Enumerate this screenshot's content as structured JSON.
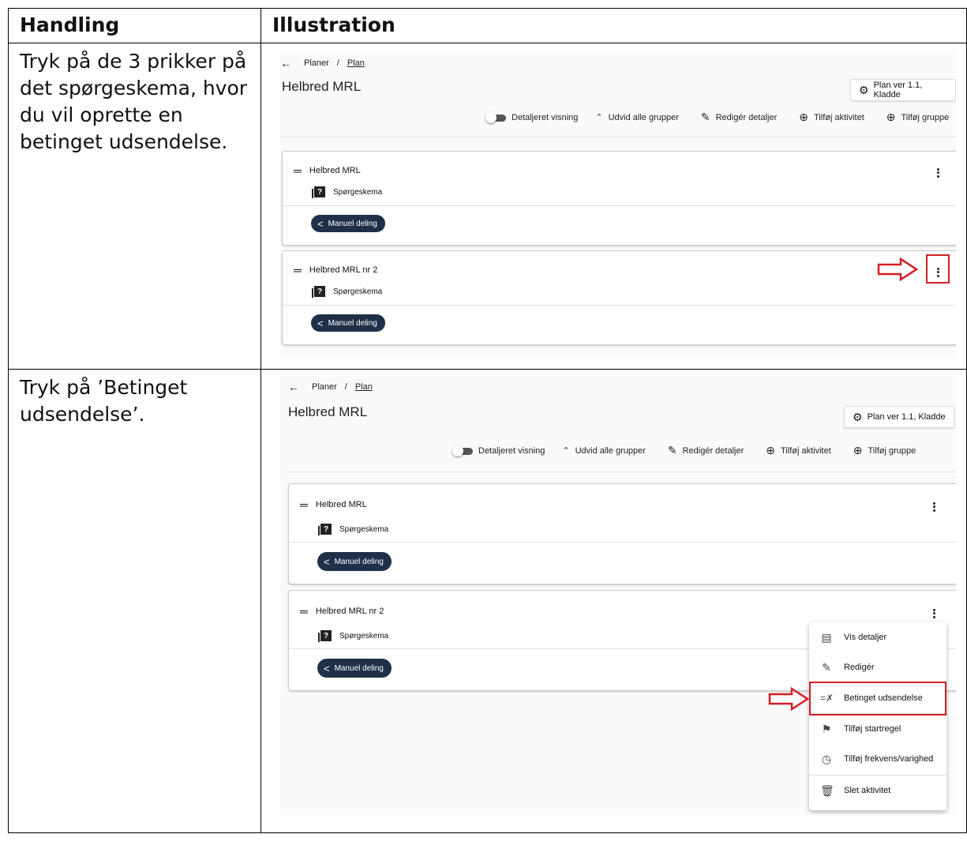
{
  "table": {
    "col_handling": "Handling",
    "col_illustration": "Illustration"
  },
  "steps": [
    {
      "text": "Tryk på de 3 prikker på det spørgeskema, hvor du vil oprette en betinget udsendelse."
    },
    {
      "text": "Tryk på ’Betinget udsendelse’."
    }
  ],
  "ui": {
    "breadcrumb_root": "Planer",
    "breadcrumb_sep": "/",
    "breadcrumb_current": "Plan",
    "page_title": "Helbred MRL",
    "plan_button": "Plan ver 1.1, Kladde",
    "toolbar": {
      "detailed_view": "Detaljeret visning",
      "expand_groups": "Udvid alle grupper",
      "edit_details": "Redigér detaljer",
      "add_activity": "Tilføj aktivitet",
      "add_group": "Tilføj gruppe"
    },
    "cards": [
      {
        "name": "Helbred MRL",
        "type": "Spørgeskema",
        "share": "Manuel deling"
      },
      {
        "name": "Helbred MRL nr 2",
        "type": "Spørgeskema",
        "share": "Manuel deling"
      }
    ],
    "menu": {
      "show_details": "Vis detaljer",
      "edit": "Redigér",
      "conditional": "Betinget udsendelse",
      "start_rule": "Tilføj startregel",
      "frequency": "Tilføj frekvens/varighed",
      "delete": "Slet aktivitet"
    }
  },
  "colors": {
    "accent_red": "#d21f26",
    "pill": "#1f3048"
  }
}
